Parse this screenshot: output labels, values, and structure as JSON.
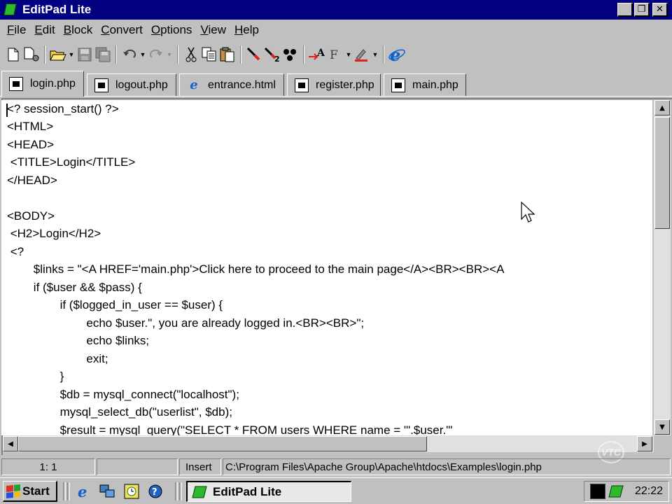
{
  "window": {
    "title": "EditPad Lite",
    "controls": [
      "minimize",
      "maximize",
      "close"
    ]
  },
  "menu": [
    {
      "label": "File",
      "key": "F",
      "rest": "ile"
    },
    {
      "label": "Edit",
      "key": "E",
      "rest": "dit"
    },
    {
      "label": "Block",
      "key": "B",
      "rest": "lock"
    },
    {
      "label": "Convert",
      "key": "C",
      "rest": "onvert"
    },
    {
      "label": "Options",
      "key": "O",
      "rest": "ptions"
    },
    {
      "label": "View",
      "key": "V",
      "rest": "iew"
    },
    {
      "label": "Help",
      "key": "H",
      "rest": "elp"
    }
  ],
  "toolbar": {
    "icons": [
      "new-file-icon",
      "new-file-options-icon",
      "open-folder-icon",
      "save-icon",
      "save-all-icon",
      "undo-icon",
      "redo-icon",
      "cut-icon",
      "copy-icon",
      "paste-icon",
      "find-icon",
      "find-next-icon",
      "replace-icon",
      "insert-char-icon",
      "font-icon",
      "color-icon",
      "internet-explorer-icon"
    ]
  },
  "tabs": [
    {
      "label": "login.php",
      "active": true,
      "icon": "php-file-icon"
    },
    {
      "label": "logout.php",
      "active": false,
      "icon": "php-file-icon"
    },
    {
      "label": "entrance.html",
      "active": false,
      "icon": "ie-file-icon"
    },
    {
      "label": "register.php",
      "active": false,
      "icon": "php-file-icon"
    },
    {
      "label": "main.php",
      "active": false,
      "icon": "php-file-icon"
    }
  ],
  "editor": {
    "lines": [
      "<? session_start() ?>",
      "<HTML>",
      "<HEAD>",
      " <TITLE>Login</TITLE>",
      "</HEAD>",
      "",
      "<BODY>",
      " <H2>Login</H2>",
      " <?",
      "\t$links = \"<A HREF='main.php'>Click here to proceed to the main page</A><BR><BR><A",
      "\tif ($user && $pass) {",
      "\t\tif ($logged_in_user == $user) {",
      "\t\t\techo $user.\", you are already logged in.<BR><BR>\";",
      "\t\t\techo $links;",
      "\t\t\texit;",
      "\t\t}",
      "\t\t$db = mysql_connect(\"localhost\");",
      "\t\tmysql_select_db(\"userlist\", $db);",
      "\t\t$result = mysql_query(\"SELECT * FROM users WHERE name = '\".$user.\"'"
    ]
  },
  "status": {
    "position": "1: 1",
    "mode": "Insert",
    "path": "C:\\Program Files\\Apache Group\\Apache\\htdocs\\Examples\\login.php"
  },
  "taskbar": {
    "start_label": "Start",
    "quick_launch": [
      "internet-explorer-icon",
      "network-icon",
      "clock-utility-icon",
      "help-icon"
    ],
    "task_label": "EditPad Lite",
    "clock": "22:22"
  },
  "watermark": "VTC"
}
